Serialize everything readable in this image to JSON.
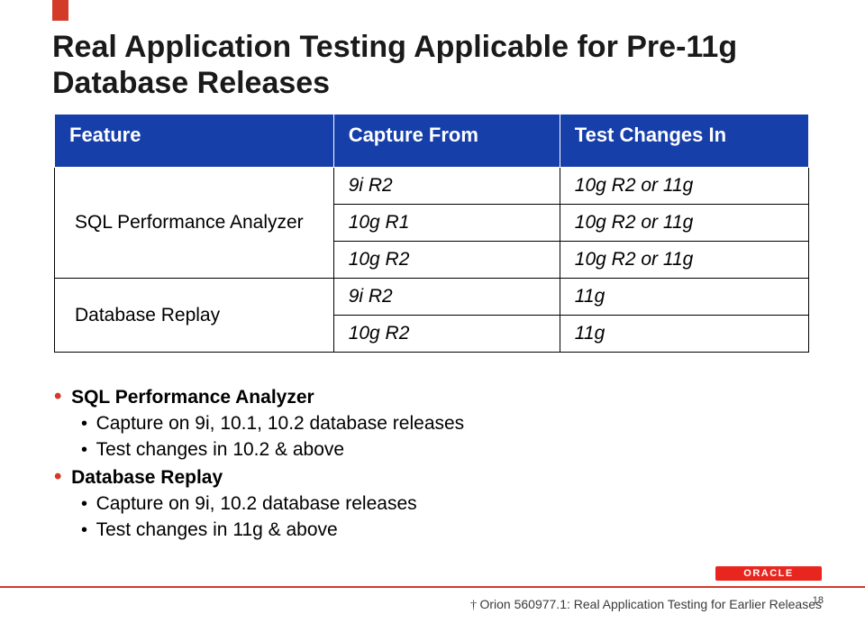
{
  "title": "Real Application Testing Applicable for Pre-11g Database Releases",
  "table": {
    "headers": {
      "feature": "Feature",
      "capture": "Capture From",
      "test": "Test Changes In"
    },
    "rows": {
      "spa_label": "SQL Performance Analyzer",
      "dbr_label": "Database Replay",
      "r1c": "9i R2",
      "r1t": "10g R2 or 11g",
      "r2c": "10g R1",
      "r2t": "10g R2 or 11g",
      "r3c": "10g R2",
      "r3t": "10g R2 or 11g",
      "r4c": "9i R2",
      "r4t": "11g",
      "r5c": "10g R2",
      "r5t": "11g"
    }
  },
  "bullets": {
    "l1": "SQL Performance Analyzer",
    "l1a": "Capture on 9i, 10.1, 10.2 database releases",
    "l1b": "Test changes in 10.2 & above",
    "l2": "Database Replay",
    "l2a": "Capture on 9i, 10.2 database releases",
    "l2b": "Test changes in 11g & above"
  },
  "logo": "ORACLE",
  "footer": {
    "page": "18",
    "text_prefix": "† ",
    "text": "Orion 560977.1: Real Application Testing for Earlier Releases"
  }
}
